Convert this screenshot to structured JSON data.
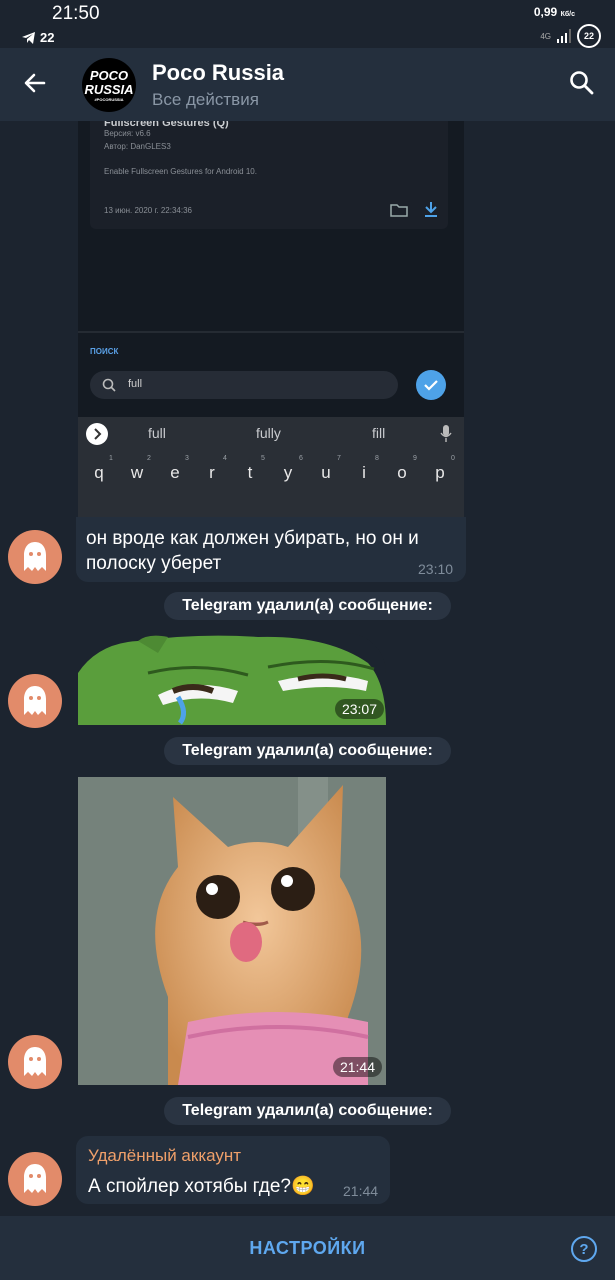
{
  "status": {
    "time": "21:50",
    "tg_count": "22",
    "speed": "0,99",
    "speed_unit": "Кб/с",
    "net": "4G",
    "battery": "22"
  },
  "header": {
    "title": "Poco Russia",
    "subtitle": "Все действия",
    "avatar_line1": "POCO",
    "avatar_line2": "RUSSIA",
    "avatar_tiny": "#POCORUSSIA"
  },
  "screenshot": {
    "card_title": "Fullscreen Gestures (Q)",
    "version": "Версия: v6.6",
    "author": "Автор: DanGLES3",
    "desc": "Enable Fullscreen Gestures for Android 10.",
    "date": "13 июн. 2020 г. 22:34:36",
    "search_label": "ПОИСК",
    "search_value": "full",
    "suggestions": [
      "full",
      "fully",
      "fill"
    ],
    "keys": [
      "q",
      "w",
      "e",
      "r",
      "t",
      "y",
      "u",
      "i",
      "o",
      "p"
    ],
    "key_nums": [
      "1",
      "2",
      "3",
      "4",
      "5",
      "6",
      "7",
      "8",
      "9",
      "0"
    ]
  },
  "messages": {
    "text1": "он вроде как должен убирать, но он и полоску уберет",
    "time1": "23:10",
    "service1": "Telegram удалил(а) сообщение:",
    "sticker_time": "23:07",
    "service2": "Telegram удалил(а) сообщение:",
    "photo_time": "21:44",
    "service3": "Telegram удалил(а) сообщение:",
    "sender": "Удалённый аккаунт",
    "text2": "А спойлер хотябы где?😁",
    "time2": "21:44"
  },
  "bottom": {
    "settings_label": "НАСТРОЙКИ",
    "help": "?"
  },
  "colors": {
    "bg": "#1c242f",
    "bar": "#242f3d",
    "accent": "#5fa8ef",
    "ghost": "#e28b6a",
    "sender": "#f0a06a"
  }
}
